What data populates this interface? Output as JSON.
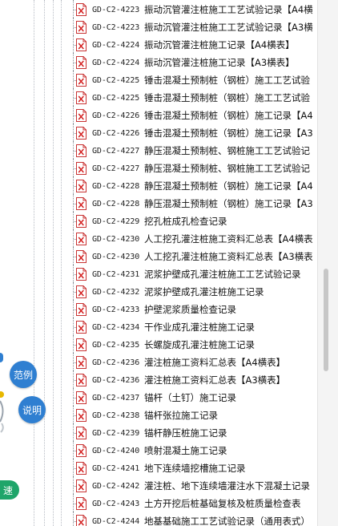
{
  "left_panel": {
    "buttons": {
      "example": "范例",
      "explain": "说明",
      "speed": "速"
    },
    "colors": {
      "blue": "#2f7fd1",
      "green": "#1fa56a"
    }
  },
  "file_list": {
    "icon": "pdf-file-icon",
    "items": [
      {
        "code": "GD-C2-4223",
        "title": "振动沉管灌注桩施工工艺试验记录【A4横"
      },
      {
        "code": "GD-C2-4223",
        "title": "振动沉管灌注桩施工工艺试验记录【A3横"
      },
      {
        "code": "GD-C2-4224",
        "title": "振动沉管灌注桩施工记录【A4横表】"
      },
      {
        "code": "GD-C2-4224",
        "title": "振动沉管灌注桩施工记录【A3横表】"
      },
      {
        "code": "GD-C2-4225",
        "title": "锤击混凝土预制桩（钢桩）施工工艺试验"
      },
      {
        "code": "GD-C2-4225",
        "title": "锤击混凝土预制桩（钢桩）施工工艺试验"
      },
      {
        "code": "GD-C2-4226",
        "title": "锤击混凝土预制桩（钢桩）施工记录【A4"
      },
      {
        "code": "GD-C2-4226",
        "title": "锤击混凝土预制桩（钢桩）施工记录【A3"
      },
      {
        "code": "GD-C2-4227",
        "title": "静压混凝土预制桩、钢桩施工工艺试验记"
      },
      {
        "code": "GD-C2-4227",
        "title": "静压混凝土预制桩、钢桩施工工艺试验记"
      },
      {
        "code": "GD-C2-4228",
        "title": "静压混凝土预制桩（钢桩）施工记录【A4"
      },
      {
        "code": "GD-C2-4228",
        "title": "静压混凝土预制桩（钢桩）施工记录【A3"
      },
      {
        "code": "GD-C2-4229",
        "title": "挖孔桩成孔检查记录"
      },
      {
        "code": "GD-C2-4230",
        "title": "人工挖孔灌注桩施工资料汇总表【A4横表"
      },
      {
        "code": "GD-C2-4230",
        "title": "人工挖孔灌注桩施工资料汇总表【A3横表"
      },
      {
        "code": "GD-C2-4231",
        "title": "泥浆护壁成孔灌注桩施工工艺试验记录"
      },
      {
        "code": "GD-C2-4232",
        "title": "泥浆护壁成孔灌注桩施工记录"
      },
      {
        "code": "GD-C2-4233",
        "title": "护壁泥浆质量检查记录"
      },
      {
        "code": "GD-C2-4234",
        "title": "干作业成孔灌注桩施工记录"
      },
      {
        "code": "GD-C2-4235",
        "title": "长螺旋成孔灌注桩施工记录"
      },
      {
        "code": "GD-C2-4236",
        "title": "灌注桩施工资料汇总表【A4横表】"
      },
      {
        "code": "GD-C2-4236",
        "title": "灌注桩施工资料汇总表【A3横表】"
      },
      {
        "code": "GD-C2-4237",
        "title": "锚杆（土钉）施工记录"
      },
      {
        "code": "GD-C2-4238",
        "title": "锚杆张拉施工记录"
      },
      {
        "code": "GD-C2-4239",
        "title": "锚杆静压桩施工记录"
      },
      {
        "code": "GD-C2-4240",
        "title": "喷射混凝土施工记录"
      },
      {
        "code": "GD-C2-4241",
        "title": "地下连续墙挖槽施工记录"
      },
      {
        "code": "GD-C2-4242",
        "title": "灌注桩、地下连续墙灌注水下混凝土记录"
      },
      {
        "code": "GD-C2-4243",
        "title": "土方开挖后桩基础复核及桩质量检查表"
      },
      {
        "code": "GD-C2-4244",
        "title": "地基基础施工工艺试验记录（通用表式）"
      }
    ]
  }
}
